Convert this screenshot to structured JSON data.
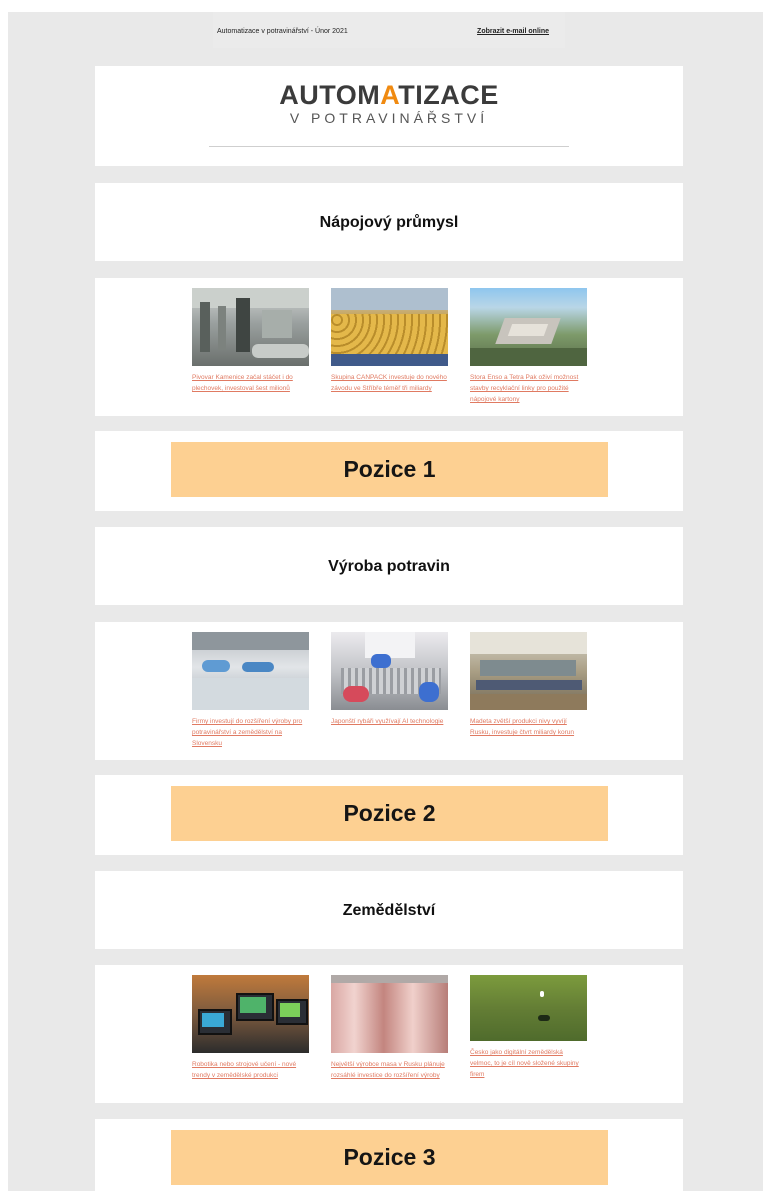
{
  "preheader": {
    "text": "Automatizace v potravinářství - Únor 2021",
    "online_link": "Zobrazit e-mail online"
  },
  "logo": {
    "main_prefix": "AUTOM",
    "main_accent": "A",
    "main_suffix": "TIZACE",
    "sub": "V POTRAVINÁŘSTVÍ"
  },
  "sections": [
    {
      "title": "Nápojový průmysl",
      "articles": [
        {
          "image": "brewery-line",
          "text": "Pivovar Kamenice začal stáčet i do plechovek, investoval šest milionů"
        },
        {
          "image": "cans-line",
          "text": "Skupina CANPACK investuje do nového závodu ve Stříbře téměř tři miliardy"
        },
        {
          "image": "aerial-plant",
          "text": "Stora Enso a Tetra Pak oživí možnost stavby recyklační linky pro použité nápojové kartony"
        }
      ],
      "banner": "Pozice 1"
    },
    {
      "title": "Výroba potravin",
      "articles": [
        {
          "image": "processing-line",
          "text": "Firmy investují do rozšíření výroby pro potravinářství a zemědělství na Slovensku"
        },
        {
          "image": "meat-lab",
          "text": "Japonští rybáři využívají AI technologie"
        },
        {
          "image": "production-hall",
          "text": "Madeta zvětší produkci nivy vyvíjí Rusku, investuje čtvrt miliardy korun"
        }
      ],
      "banner": "Pozice 2"
    },
    {
      "title": "Zemědělství",
      "articles": [
        {
          "image": "tractor-cabin",
          "text": "Robotika nebo strojové učení - nové trendy v zemědělské produkci"
        },
        {
          "image": "meat-carcasses",
          "text": "Největší výrobce masa v Rusku plánuje rozsáhlé investice do rozšíření výroby"
        },
        {
          "image": "field-drone",
          "text": "Česko jako digitální zemědělská velmoc, to je cíl nově složené skupiny firem"
        }
      ],
      "banner": "Pozice 3"
    }
  ],
  "colors": {
    "background": "#e9e9e9",
    "banner": "#fdd092",
    "link": "#e07a62",
    "logo_text": "#3b3b3b",
    "logo_accent": "#f08a10"
  }
}
